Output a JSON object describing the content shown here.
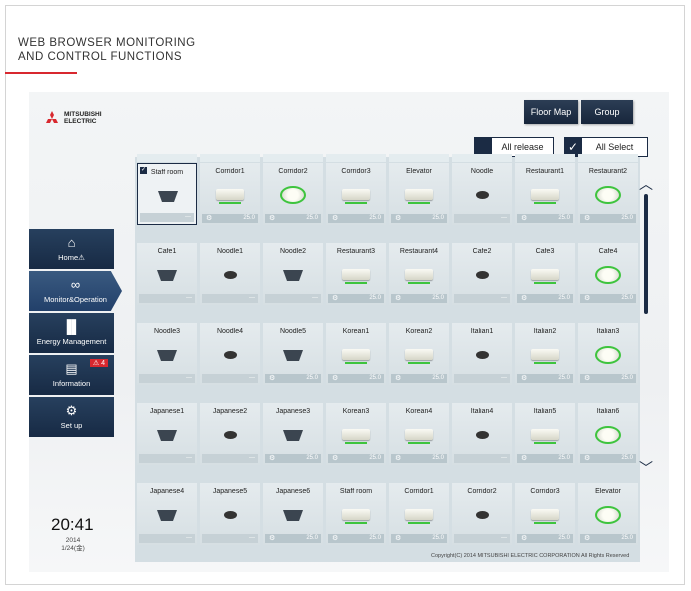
{
  "page": {
    "header_line1": "WEB BROWSER MONITORING",
    "header_line2": "AND CONTROL FUNCTIONS"
  },
  "brand": {
    "logo_text_1": "MITSUBISHI",
    "logo_text_2": "ELECTRIC",
    "accent_color": "#d8282f"
  },
  "top_nav": {
    "floor_map": "Floor Map",
    "group": "Group"
  },
  "selection": {
    "all_release": "All release",
    "all_select": "All Select"
  },
  "sidebar": {
    "items": [
      {
        "label": "Home",
        "icon": "home-icon",
        "glyph": "⌂",
        "warn": "⚠"
      },
      {
        "label": "Monitor&Operation",
        "icon": "glasses-icon",
        "glyph": "∞"
      },
      {
        "label": "Energy Management",
        "icon": "bar-chart-icon",
        "glyph": "▐▌"
      },
      {
        "label": "Information",
        "icon": "info-document-icon",
        "glyph": "▤",
        "badge": "⚠ 4"
      },
      {
        "label": "Set up",
        "icon": "gear-icon",
        "glyph": "⚙"
      }
    ]
  },
  "units": [
    {
      "name": "Staff room",
      "type": "ceiling",
      "temp": "---",
      "selected": true
    },
    {
      "name": "Corridor1",
      "type": "wall",
      "temp": "25.0"
    },
    {
      "name": "Corridor2",
      "type": "cassette",
      "temp": "25.0"
    },
    {
      "name": "Corridor3",
      "type": "wall",
      "temp": "25.0"
    },
    {
      "name": "Elevator",
      "type": "wall",
      "temp": "25.0"
    },
    {
      "name": "Noodle",
      "type": "dot",
      "temp": "---"
    },
    {
      "name": "Restaurant1",
      "type": "wall",
      "temp": "25.0"
    },
    {
      "name": "Restaurant2",
      "type": "cassette",
      "temp": "25.0"
    },
    {
      "name": "Cafe1",
      "type": "ceiling",
      "temp": "---"
    },
    {
      "name": "Noodle1",
      "type": "dot",
      "temp": "---"
    },
    {
      "name": "Noodle2",
      "type": "ceiling",
      "temp": "---"
    },
    {
      "name": "Restaurant3",
      "type": "wall",
      "temp": "25.0"
    },
    {
      "name": "Restaurant4",
      "type": "wall",
      "temp": "25.0"
    },
    {
      "name": "Cafe2",
      "type": "dot",
      "temp": "---"
    },
    {
      "name": "Cafe3",
      "type": "wall",
      "temp": "25.0"
    },
    {
      "name": "Cafe4",
      "type": "cassette",
      "temp": "25.0"
    },
    {
      "name": "Noodle3",
      "type": "ceiling",
      "temp": "---"
    },
    {
      "name": "Noodle4",
      "type": "dot",
      "temp": "---"
    },
    {
      "name": "Noodle5",
      "type": "ceiling",
      "temp": "25.0"
    },
    {
      "name": "Korean1",
      "type": "wall",
      "temp": "25.0"
    },
    {
      "name": "Korean2",
      "type": "wall",
      "temp": "25.0"
    },
    {
      "name": "Italian1",
      "type": "dot",
      "temp": "---"
    },
    {
      "name": "Italian2",
      "type": "wall",
      "temp": "25.0"
    },
    {
      "name": "Italian3",
      "type": "cassette",
      "temp": "25.0"
    },
    {
      "name": "Japanese1",
      "type": "ceiling",
      "temp": "---"
    },
    {
      "name": "Japanese2",
      "type": "dot",
      "temp": "---"
    },
    {
      "name": "Japanese3",
      "type": "ceiling",
      "temp": "25.0"
    },
    {
      "name": "Korean3",
      "type": "wall",
      "temp": "25.0"
    },
    {
      "name": "Korean4",
      "type": "wall",
      "temp": "25.0"
    },
    {
      "name": "Italian4",
      "type": "dot",
      "temp": "---"
    },
    {
      "name": "Italian5",
      "type": "wall",
      "temp": "25.0"
    },
    {
      "name": "Italian6",
      "type": "cassette",
      "temp": "25.0"
    },
    {
      "name": "Japanese4",
      "type": "ceiling",
      "temp": "---"
    },
    {
      "name": "Japanese5",
      "type": "dot",
      "temp": "---"
    },
    {
      "name": "Japanese6",
      "type": "ceiling",
      "temp": "25.0"
    },
    {
      "name": "Staff room",
      "type": "wall",
      "temp": "25.0"
    },
    {
      "name": "Corridor1",
      "type": "wall",
      "temp": "25.0"
    },
    {
      "name": "Corridor2",
      "type": "dot",
      "temp": "---"
    },
    {
      "name": "Corridor3",
      "type": "wall",
      "temp": "25.0"
    },
    {
      "name": "Elevator",
      "type": "cassette",
      "temp": "25.0"
    }
  ],
  "clock": {
    "time": "20:41",
    "year": "2014",
    "date": "1/24(金)"
  },
  "footer": {
    "copyright": "Copyright(C) 2014 MITSUBISHI ELECTRIC CORPORATION All Rights Reserved"
  }
}
